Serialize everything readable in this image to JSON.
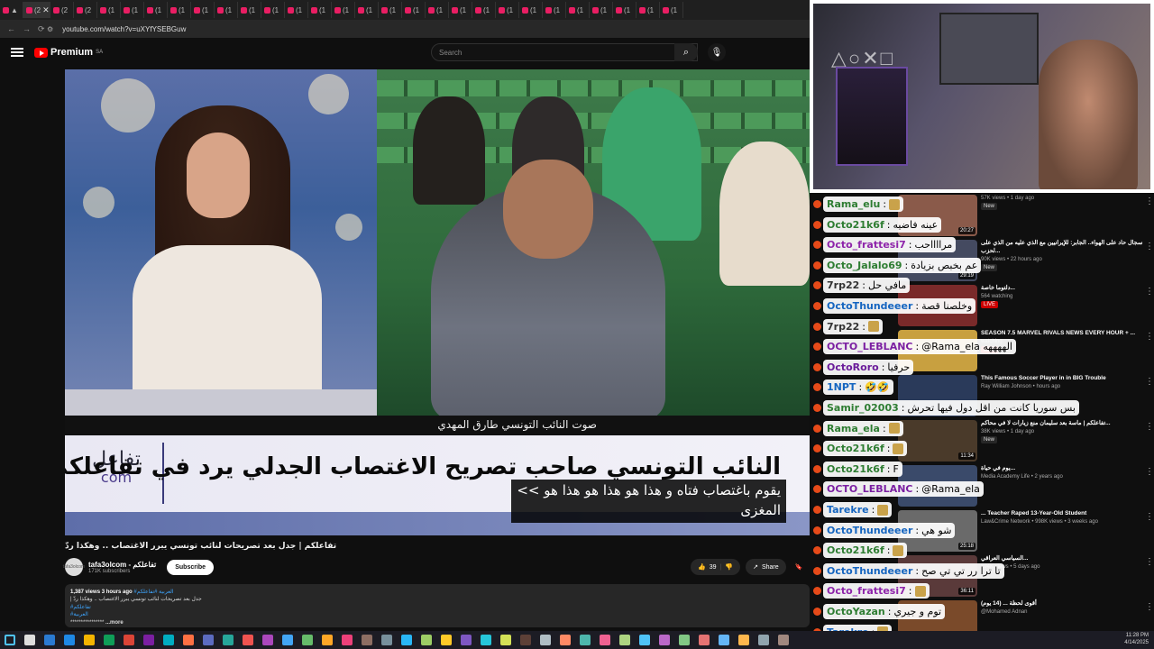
{
  "browser": {
    "url": "youtube.com/watch?v=uXYfYSEBGuw",
    "tabs": [
      {
        "label": "▲"
      },
      {
        "label": "(2"
      },
      {
        "label": "(2"
      },
      {
        "label": "(2"
      },
      {
        "label": "(1"
      },
      {
        "label": "(1"
      },
      {
        "label": "(1"
      },
      {
        "label": "(1"
      },
      {
        "label": "(1"
      },
      {
        "label": "(1"
      },
      {
        "label": "(1"
      },
      {
        "label": "(1"
      },
      {
        "label": "(1"
      },
      {
        "label": "(1"
      },
      {
        "label": "(1"
      },
      {
        "label": "(1"
      },
      {
        "label": "(1"
      },
      {
        "label": "(1"
      },
      {
        "label": "(1"
      },
      {
        "label": "(1"
      },
      {
        "label": "(1"
      },
      {
        "label": "(1"
      },
      {
        "label": "(1"
      },
      {
        "label": "(1"
      },
      {
        "label": "(1"
      },
      {
        "label": "(1"
      },
      {
        "label": "(1"
      },
      {
        "label": "(1"
      },
      {
        "label": "(1"
      }
    ]
  },
  "youtube": {
    "logo_text": "Premium",
    "logo_region": "SA",
    "search_placeholder": "Search"
  },
  "video": {
    "caption_strip": "صوت النائب التونسي طارق المهدي",
    "brand_ar": "تفاعل",
    "brand_com": "com",
    "headline": "النائب التونسي صاحب تصريح الاغتصاب الجدلي يرد في تفاعلكم",
    "subtitle_line1": "<< يقوم باغتصاب فتاه و  هذا هو هذا هو هذا هو",
    "subtitle_line2": "المغزى",
    "title": "تفاعلكم | جدل بعد تصريحات لنائب تونسي يبرر الاغتصاب .. وهكذا ردّ",
    "channel_name": "tafa3olcom - تفاعلكم",
    "channel_avatar": "tafa3olcom",
    "subscribers": "171K subscribers",
    "subscribe_label": "Subscribe",
    "likes": "39",
    "share_label": "Share",
    "views": "1,387 views",
    "age": "3 hours ago",
    "hashtags": "#العربية #تفاعلكم",
    "desc_line1": "| جدل بعد تصريحات لنائب تونسي يبرر الاغتصاب .. وهكذا ردّ",
    "desc_tag1": "#تفاعلكم",
    "desc_tag2": "#العربية",
    "desc_more": "...more"
  },
  "recommendations": [
    {
      "title": "",
      "meta": "57K views • 1 day ago",
      "badge": "New",
      "duration": "20:27"
    },
    {
      "title": "سجال حاد على الهواء.. الجابر: للإيرانيين مع الذي عليه من الذي على لحزب...",
      "meta": "90K views • 22 hours ago",
      "badge": "New",
      "duration": "29:19"
    },
    {
      "title": "دلتوما خاصة...",
      "meta": "564 watching",
      "badge": "LIVE",
      "duration": ""
    },
    {
      "title": "SEASON 7.5 MARVEL RIVALS NEWS EVERY HOUR + ...",
      "meta": "watching",
      "badge": "LIVE",
      "duration": ""
    },
    {
      "title": "This Famous Soccer Player in in BIG Trouble",
      "meta": "Ray William Johnson • hours ago",
      "badge": "",
      "duration": ""
    },
    {
      "title": "تفاعلكم | ماسة بعد سليمان منع زيارات لا في محاكم...",
      "meta": "38K views • 1 day ago",
      "badge": "New",
      "duration": "11:34"
    },
    {
      "title": "يوم في حياة...",
      "meta": "Media Academy Life • 2 years ago",
      "badge": "",
      "duration": ""
    },
    {
      "title": "... Teacher Raped 13-Year-Old Student",
      "meta": "Law&Crime Network • 998K views • 3 weeks ago",
      "badge": "",
      "duration": "25:18"
    },
    {
      "title": "السياسي العراقي...",
      "meta": "294K views • 5 days ago",
      "badge": "",
      "duration": "36:11"
    },
    {
      "title": "أقوى لحظة ... (14 يوم)",
      "meta": "@Mohamed Adnan",
      "badge": "",
      "duration": ""
    }
  ],
  "chat": [
    {
      "user": "Rama_elu",
      "msg": "",
      "color": "#2e7d32"
    },
    {
      "user": "Octo21k6f",
      "msg": "عينه فاضيه",
      "color": "#2e7d32"
    },
    {
      "user": "Octo_frattesi7",
      "msg": "مرااااحب",
      "color": "#8e24aa"
    },
    {
      "user": "Octo_Jalalo69",
      "msg": "عم بخبص بزيادة",
      "color": "#2e7d32"
    },
    {
      "user": "7rp22",
      "msg": "مافي حل",
      "color": "#333"
    },
    {
      "user": "OctoThundeeer",
      "msg": "وخلصنا قصة",
      "color": "#1565c0"
    },
    {
      "user": "7rp22",
      "msg": "",
      "color": "#333"
    },
    {
      "user": "OCTO_LEBLANC",
      "msg": "@Rama_ela  الههههه",
      "color": "#7b1fa2"
    },
    {
      "user": "OctoRoro",
      "msg": "حرفيا",
      "color": "#6a1b9a"
    },
    {
      "user": "1NPT",
      "msg": "🤣🤣",
      "color": "#1565c0"
    },
    {
      "user": "Samir_02003",
      "msg": "بس سوريا كانت من اقل دول فيها تحرش",
      "color": "#2e7d32"
    },
    {
      "user": "Rama_ela",
      "msg": "",
      "color": "#2e7d32"
    },
    {
      "user": "Octo21k6f",
      "msg": "",
      "color": "#2e7d32"
    },
    {
      "user": "Octo21k6f",
      "msg": "F",
      "color": "#2e7d32"
    },
    {
      "user": "OCTO_LEBLANC",
      "msg": "@Rama_ela",
      "color": "#7b1fa2"
    },
    {
      "user": "Tarekre",
      "msg": "",
      "color": "#1565c0"
    },
    {
      "user": "OctoThundeeer",
      "msg": "شو هي",
      "color": "#1565c0"
    },
    {
      "user": "Octo21k6f",
      "msg": "",
      "color": "#2e7d32"
    },
    {
      "user": "OctoThundeeer",
      "msg": "تا ترا رر تي تي صح",
      "color": "#1565c0"
    },
    {
      "user": "Octo_frattesi7",
      "msg": "",
      "color": "#8e24aa"
    },
    {
      "user": "OctoYazan",
      "msg": "توم و جيري",
      "color": "#2e7d32"
    },
    {
      "user": "Tarekre",
      "msg": "",
      "color": "#1565c0"
    }
  ],
  "clock": {
    "time": "11:28 PM",
    "date": "4/14/2025"
  }
}
